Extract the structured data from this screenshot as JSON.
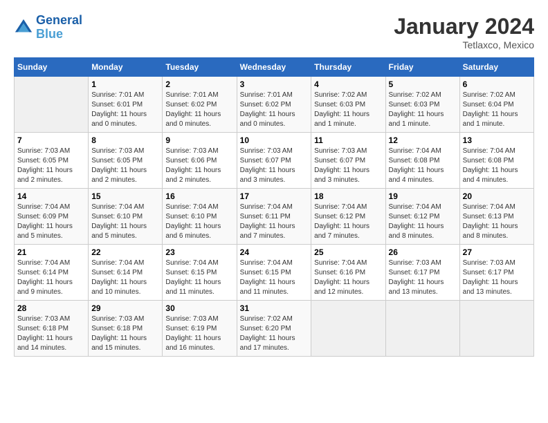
{
  "header": {
    "logo_line1": "General",
    "logo_line2": "Blue",
    "title": "January 2024",
    "subtitle": "Tetlaxco, Mexico"
  },
  "days_of_week": [
    "Sunday",
    "Monday",
    "Tuesday",
    "Wednesday",
    "Thursday",
    "Friday",
    "Saturday"
  ],
  "weeks": [
    [
      {
        "day": "",
        "sunrise": "",
        "sunset": "",
        "daylight": ""
      },
      {
        "day": "1",
        "sunrise": "7:01 AM",
        "sunset": "6:01 PM",
        "daylight": "11 hours and 0 minutes."
      },
      {
        "day": "2",
        "sunrise": "7:01 AM",
        "sunset": "6:02 PM",
        "daylight": "11 hours and 0 minutes."
      },
      {
        "day": "3",
        "sunrise": "7:01 AM",
        "sunset": "6:02 PM",
        "daylight": "11 hours and 0 minutes."
      },
      {
        "day": "4",
        "sunrise": "7:02 AM",
        "sunset": "6:03 PM",
        "daylight": "11 hours and 1 minute."
      },
      {
        "day": "5",
        "sunrise": "7:02 AM",
        "sunset": "6:03 PM",
        "daylight": "11 hours and 1 minute."
      },
      {
        "day": "6",
        "sunrise": "7:02 AM",
        "sunset": "6:04 PM",
        "daylight": "11 hours and 1 minute."
      }
    ],
    [
      {
        "day": "7",
        "sunrise": "7:03 AM",
        "sunset": "6:05 PM",
        "daylight": "11 hours and 2 minutes."
      },
      {
        "day": "8",
        "sunrise": "7:03 AM",
        "sunset": "6:05 PM",
        "daylight": "11 hours and 2 minutes."
      },
      {
        "day": "9",
        "sunrise": "7:03 AM",
        "sunset": "6:06 PM",
        "daylight": "11 hours and 2 minutes."
      },
      {
        "day": "10",
        "sunrise": "7:03 AM",
        "sunset": "6:07 PM",
        "daylight": "11 hours and 3 minutes."
      },
      {
        "day": "11",
        "sunrise": "7:03 AM",
        "sunset": "6:07 PM",
        "daylight": "11 hours and 3 minutes."
      },
      {
        "day": "12",
        "sunrise": "7:04 AM",
        "sunset": "6:08 PM",
        "daylight": "11 hours and 4 minutes."
      },
      {
        "day": "13",
        "sunrise": "7:04 AM",
        "sunset": "6:08 PM",
        "daylight": "11 hours and 4 minutes."
      }
    ],
    [
      {
        "day": "14",
        "sunrise": "7:04 AM",
        "sunset": "6:09 PM",
        "daylight": "11 hours and 5 minutes."
      },
      {
        "day": "15",
        "sunrise": "7:04 AM",
        "sunset": "6:10 PM",
        "daylight": "11 hours and 5 minutes."
      },
      {
        "day": "16",
        "sunrise": "7:04 AM",
        "sunset": "6:10 PM",
        "daylight": "11 hours and 6 minutes."
      },
      {
        "day": "17",
        "sunrise": "7:04 AM",
        "sunset": "6:11 PM",
        "daylight": "11 hours and 7 minutes."
      },
      {
        "day": "18",
        "sunrise": "7:04 AM",
        "sunset": "6:12 PM",
        "daylight": "11 hours and 7 minutes."
      },
      {
        "day": "19",
        "sunrise": "7:04 AM",
        "sunset": "6:12 PM",
        "daylight": "11 hours and 8 minutes."
      },
      {
        "day": "20",
        "sunrise": "7:04 AM",
        "sunset": "6:13 PM",
        "daylight": "11 hours and 8 minutes."
      }
    ],
    [
      {
        "day": "21",
        "sunrise": "7:04 AM",
        "sunset": "6:14 PM",
        "daylight": "11 hours and 9 minutes."
      },
      {
        "day": "22",
        "sunrise": "7:04 AM",
        "sunset": "6:14 PM",
        "daylight": "11 hours and 10 minutes."
      },
      {
        "day": "23",
        "sunrise": "7:04 AM",
        "sunset": "6:15 PM",
        "daylight": "11 hours and 11 minutes."
      },
      {
        "day": "24",
        "sunrise": "7:04 AM",
        "sunset": "6:15 PM",
        "daylight": "11 hours and 11 minutes."
      },
      {
        "day": "25",
        "sunrise": "7:04 AM",
        "sunset": "6:16 PM",
        "daylight": "11 hours and 12 minutes."
      },
      {
        "day": "26",
        "sunrise": "7:03 AM",
        "sunset": "6:17 PM",
        "daylight": "11 hours and 13 minutes."
      },
      {
        "day": "27",
        "sunrise": "7:03 AM",
        "sunset": "6:17 PM",
        "daylight": "11 hours and 13 minutes."
      }
    ],
    [
      {
        "day": "28",
        "sunrise": "7:03 AM",
        "sunset": "6:18 PM",
        "daylight": "11 hours and 14 minutes."
      },
      {
        "day": "29",
        "sunrise": "7:03 AM",
        "sunset": "6:18 PM",
        "daylight": "11 hours and 15 minutes."
      },
      {
        "day": "30",
        "sunrise": "7:03 AM",
        "sunset": "6:19 PM",
        "daylight": "11 hours and 16 minutes."
      },
      {
        "day": "31",
        "sunrise": "7:02 AM",
        "sunset": "6:20 PM",
        "daylight": "11 hours and 17 minutes."
      },
      {
        "day": "",
        "sunrise": "",
        "sunset": "",
        "daylight": ""
      },
      {
        "day": "",
        "sunrise": "",
        "sunset": "",
        "daylight": ""
      },
      {
        "day": "",
        "sunrise": "",
        "sunset": "",
        "daylight": ""
      }
    ]
  ]
}
